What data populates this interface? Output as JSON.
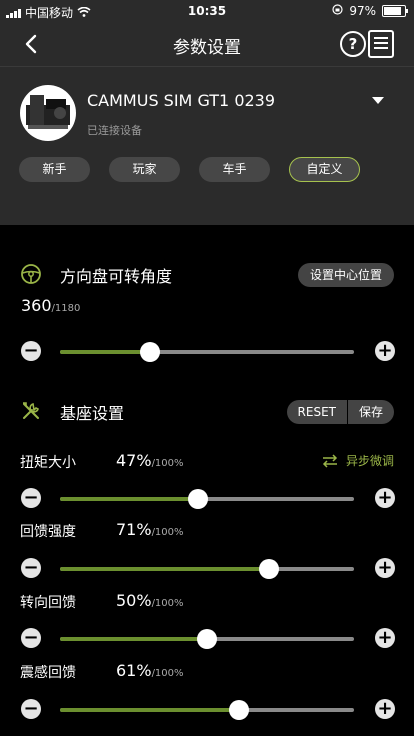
{
  "status": {
    "carrier": "中国移动",
    "time": "10:35",
    "battery": "97%",
    "battery_level": 0.97
  },
  "header": {
    "title": "参数设置"
  },
  "device": {
    "name": "CAMMUS SIM GT1 0239",
    "status": "已连接设备"
  },
  "presets": [
    {
      "label": "新手",
      "active": false
    },
    {
      "label": "玩家",
      "active": false
    },
    {
      "label": "车手",
      "active": false
    },
    {
      "label": "自定义",
      "active": true
    }
  ],
  "rotation": {
    "title": "方向盘可转角度",
    "center_btn": "设置中心位置",
    "value": "360",
    "max": "/1180",
    "fraction": 0.305
  },
  "base": {
    "title": "基座设置",
    "reset": "RESET",
    "save": "保存"
  },
  "async_label": "异步微调",
  "params": [
    {
      "label": "扭矩大小",
      "value": "47%",
      "max": "/100%",
      "fraction": 0.47
    },
    {
      "label": "回馈强度",
      "value": "71%",
      "max": "/100%",
      "fraction": 0.71
    },
    {
      "label": "转向回馈",
      "value": "50%",
      "max": "/100%",
      "fraction": 0.5
    },
    {
      "label": "震感回馈",
      "value": "61%",
      "max": "/100%",
      "fraction": 0.61
    }
  ],
  "controls": {
    "minus": "−",
    "plus": "+"
  }
}
